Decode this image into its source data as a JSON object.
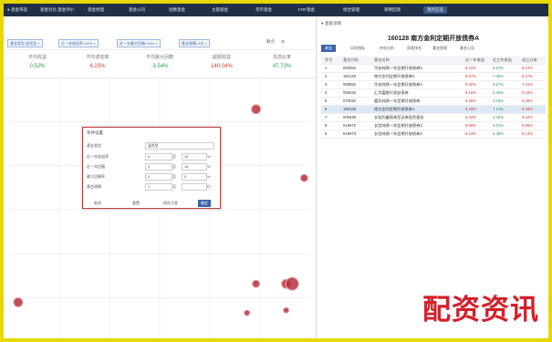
{
  "nav": {
    "items": [
      {
        "label": "● 基金筛选"
      },
      {
        "label": "基金对比 基金评价"
      },
      {
        "label": "基金经理"
      },
      {
        "label": "基金公司"
      },
      {
        "label": "指数基金"
      },
      {
        "label": "主题基金"
      },
      {
        "label": "货币基金"
      },
      {
        "label": "FOF基金"
      },
      {
        "label": "组合管理"
      },
      {
        "label": "策略回测"
      },
      {
        "label": "我的自选"
      }
    ]
  },
  "filters": {
    "chips": [
      {
        "label": "基金类型:混合型 ×"
      },
      {
        "label": "近一年收益率>10% ×"
      },
      {
        "label": "近一年最大回撤<15% ×"
      },
      {
        "label": "基金规模>1亿 ×"
      }
    ],
    "tools": {
      "select": "散点",
      "settings": "⚙"
    }
  },
  "stats": [
    {
      "label": "平均收益",
      "value": "0.52%",
      "tone": "green"
    },
    {
      "label": "平均波动率",
      "value": "6.25%",
      "tone": "red"
    },
    {
      "label": "平均最大回撤",
      "value": "-3.54%",
      "tone": "green"
    },
    {
      "label": "超额收益",
      "value": "140.04%",
      "tone": "red"
    },
    {
      "label": "信息比率",
      "value": "47.73%",
      "tone": "green"
    }
  ],
  "plot": {
    "points": [
      {
        "x": 0.82,
        "y": 0.88,
        "r": 5
      },
      {
        "x": 0.98,
        "y": 0.62,
        "r": 4
      },
      {
        "x": 0.82,
        "y": 0.22,
        "r": 4
      },
      {
        "x": 0.92,
        "y": 0.22,
        "r": 5
      },
      {
        "x": 0.94,
        "y": 0.22,
        "r": 7
      },
      {
        "x": 0.92,
        "y": 0.12,
        "r": 3
      },
      {
        "x": 0.79,
        "y": 0.11,
        "r": 3
      },
      {
        "x": 0.03,
        "y": 0.15,
        "r": 5
      }
    ]
  },
  "dialog": {
    "title": "条件设置",
    "rows": [
      {
        "label": "基金类型",
        "value": "混合型"
      },
      {
        "label": "近一年收益率",
        "min": "0",
        "max": "10",
        "unit": "%",
        "sep": "至"
      },
      {
        "label": "近一年回撤",
        "min": "0",
        "max": "15",
        "unit": "%",
        "sep": "至"
      },
      {
        "label": "最大回撤率",
        "min": "0",
        "max": "5",
        "unit": "%",
        "sep": "至"
      },
      {
        "label": "基金规模",
        "min": "1",
        "max": "",
        "unit": "亿",
        "sep": "至"
      }
    ],
    "buttons": {
      "cancel": "取消",
      "reset": "重置",
      "save": "保存方案",
      "confirm": "确定"
    }
  },
  "right": {
    "header": "● 基金详情",
    "title": "160128 南方金利定期开放债券A",
    "tabs": [
      {
        "label": "收益",
        "active": true
      },
      {
        "label": "风险指标"
      },
      {
        "label": "持仓分析"
      },
      {
        "label": "同类排名"
      },
      {
        "label": "基金经理"
      },
      {
        "label": "基金公告"
      }
    ],
    "table": {
      "headers": [
        "序号",
        "基金代码",
        "基金名称",
        "近一年收益",
        "近三年收益",
        "成立以来"
      ],
      "rows": [
        {
          "no": "1",
          "code": "000553",
          "name": "华安纯债一年定期开放债券C",
          "r1": "6.12%",
          "r3": "6.57%",
          "r5": "6.12%",
          "t1": "red",
          "t2": "green",
          "t3": "red"
        },
        {
          "no": "2",
          "code": "160128",
          "name": "南方金利定期开放债券C",
          "r1": "6.27%",
          "r3": "7.06%",
          "r5": "8.27%",
          "t1": "red",
          "t2": "green",
          "t3": "red"
        },
        {
          "no": "3",
          "code": "000552",
          "name": "华安纯债一年定期开放债券A",
          "r1": "6.30%",
          "r3": "6.57%",
          "r5": "7.21%",
          "t1": "red",
          "t2": "green",
          "t3": "red"
        },
        {
          "no": "4",
          "code": "006425",
          "name": "汇添富稳兴收益债券",
          "r1": "6.15%",
          "r3": "5.26%",
          "r5": "6.15%",
          "t1": "red",
          "t2": "green",
          "t3": "red"
        },
        {
          "no": "5",
          "code": "070020",
          "name": "嘉实纯债一年定期开放债券",
          "r1": "6.29%",
          "r3": "3.06%",
          "r5": "6.29%",
          "t1": "red",
          "t2": "green",
          "t3": "red"
        },
        {
          "no": "6",
          "code": "160128",
          "name": "南方金利定期开放债券A",
          "r1": "6.43%",
          "r3": "7.14%",
          "r5": "6.43%",
          "t1": "red",
          "t2": "green",
          "t3": "red",
          "selected": true
        },
        {
          "no": "7",
          "code": "000638",
          "name": "长信利鑫债券型证券投资基金",
          "r1": "5.42%",
          "r3": "4.46%",
          "r5": "5.42%",
          "t1": "red",
          "t2": "green",
          "t3": "red"
        },
        {
          "no": "8",
          "code": "519972",
          "name": "长信纯债一年定期开放债券C",
          "r1": "5.58%",
          "r3": "5.01%",
          "r5": "5.58%",
          "t1": "red",
          "t2": "green",
          "t3": "red"
        },
        {
          "no": "9",
          "code": "519973",
          "name": "长信纯债一年定期开放债券A",
          "r1": "6.14%",
          "r3": "5.39%",
          "r5": "6.14%",
          "t1": "red",
          "t2": "green",
          "t3": "red"
        }
      ]
    }
  },
  "watermark": "配资资讯",
  "colors": {
    "accent": "#3a63a8",
    "dot": "#b5303c",
    "nav": "#1f2f48",
    "frame": "#e8d700"
  }
}
